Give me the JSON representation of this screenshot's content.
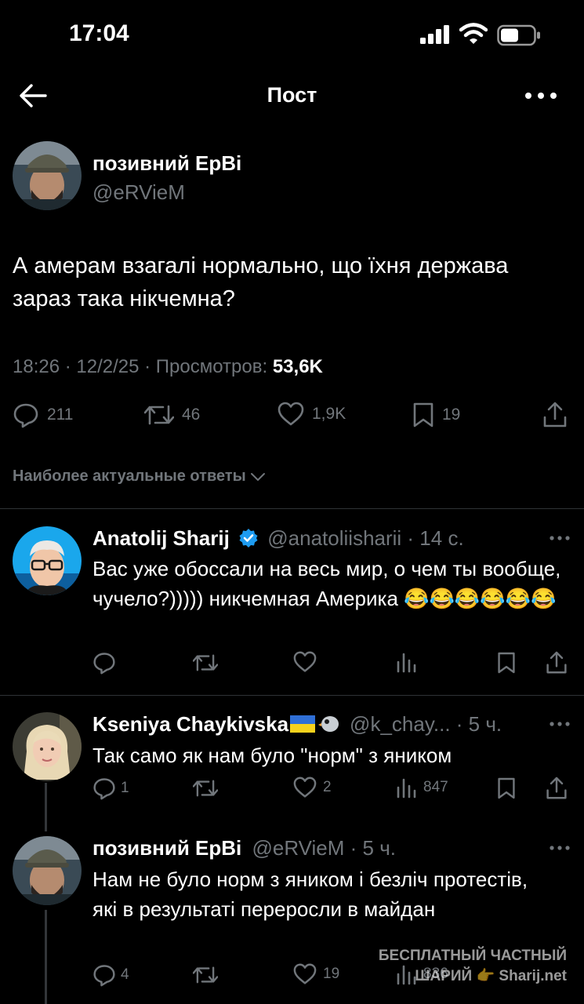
{
  "status_bar": {
    "time": "17:04"
  },
  "nav": {
    "title": "Пост"
  },
  "post": {
    "author_name": "позивний ЕрВі",
    "author_handle": "@eRVieM",
    "text": "А амерам взагалі нормально, що їхня держава зараз така нікчемна?",
    "timestamp": "18:26 · 12/2/25 · Просмотров: ",
    "views": "53,6K",
    "replies": "211",
    "reposts": "46",
    "likes": "1,9K",
    "bookmarks": "19"
  },
  "sort_label": "Наиболее актуальные ответы",
  "replies": [
    {
      "name": "Anatolij Sharij",
      "handle": "@anatoliisharii",
      "time": " · 14 с.",
      "verified": true,
      "text": "Вас уже обоссали на весь мир, о чем ты вообще, чучело?))))) никчемная Америка 😂😂😂😂😂😂"
    },
    {
      "name": "Kseniya Chaykivska",
      "flag": "🇺🇦",
      "handle": "@k_chay...",
      "time": " · 5 ч.",
      "text": "Так само як нам було \"норм\" з яником",
      "replies": "1",
      "likes": "2",
      "views": "847"
    },
    {
      "name": "позивний ЕрВі",
      "handle": "@eRVieM",
      "time": " · 5 ч.",
      "text": "Нам не було норм з яником і безліч протестів, які в результаті переросли в майдан",
      "replies": "4",
      "likes": "19",
      "views": "836"
    }
  ],
  "watermark": {
    "line1": "БЕСПЛАТНЫЙ ЧАСТНЫЙ",
    "line2": "ШАРИЙ 👉 Sharij.net"
  },
  "colors": {
    "background": "#000000",
    "text": "#e7e9ea",
    "muted": "#71767b",
    "verified": "#1d9bf0",
    "divider": "#2f3336"
  }
}
